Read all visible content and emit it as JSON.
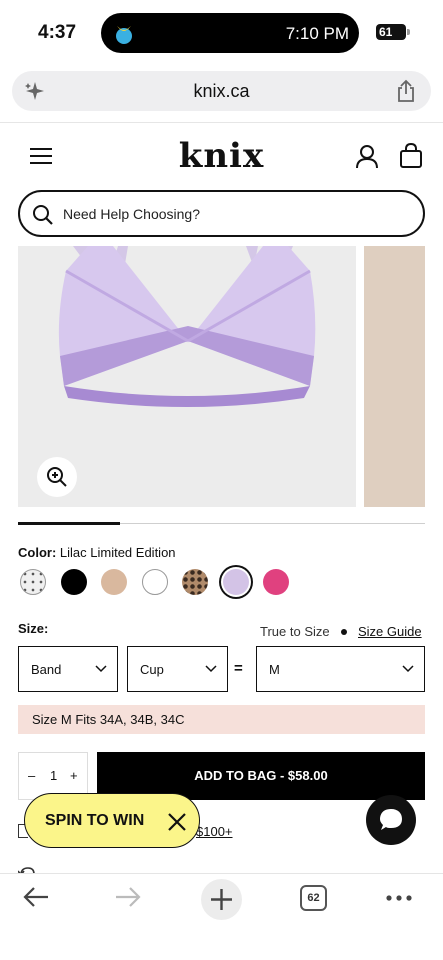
{
  "status": {
    "time": "4:37",
    "island_time": "7:10 PM",
    "battery": "61"
  },
  "browser": {
    "url": "knix.ca",
    "tab_count": "62"
  },
  "site": {
    "logo": "knix",
    "search_placeholder": "Need Help Choosing?"
  },
  "gallery": {
    "progress": 0.25
  },
  "product": {
    "color_label": "Color:",
    "color_value": "Lilac Limited Edition",
    "swatches": [
      {
        "name": "polka-dot",
        "color": "#f0f0f0"
      },
      {
        "name": "black",
        "color": "#000000"
      },
      {
        "name": "beige",
        "color": "#d9b89e"
      },
      {
        "name": "white",
        "color": "#ffffff"
      },
      {
        "name": "leopard",
        "color": "#8a6a55"
      },
      {
        "name": "lilac",
        "color": "#d3c3e6",
        "selected": true
      },
      {
        "name": "pink",
        "color": "#e0417f"
      }
    ],
    "size_label": "Size:",
    "true_to_size": "True to Size",
    "size_guide": "Size Guide",
    "band": "Band",
    "cup": "Cup",
    "equals": "=",
    "size_value": "M",
    "fits": "Size M Fits 34A, 34B, 34C",
    "qty_minus": "–",
    "qty_value": "1",
    "qty_plus": "+",
    "add_to_bag": "ADD TO BAG - $58.00",
    "free_shipping": "$100+"
  },
  "promo": {
    "spin": "SPIN TO WIN"
  }
}
